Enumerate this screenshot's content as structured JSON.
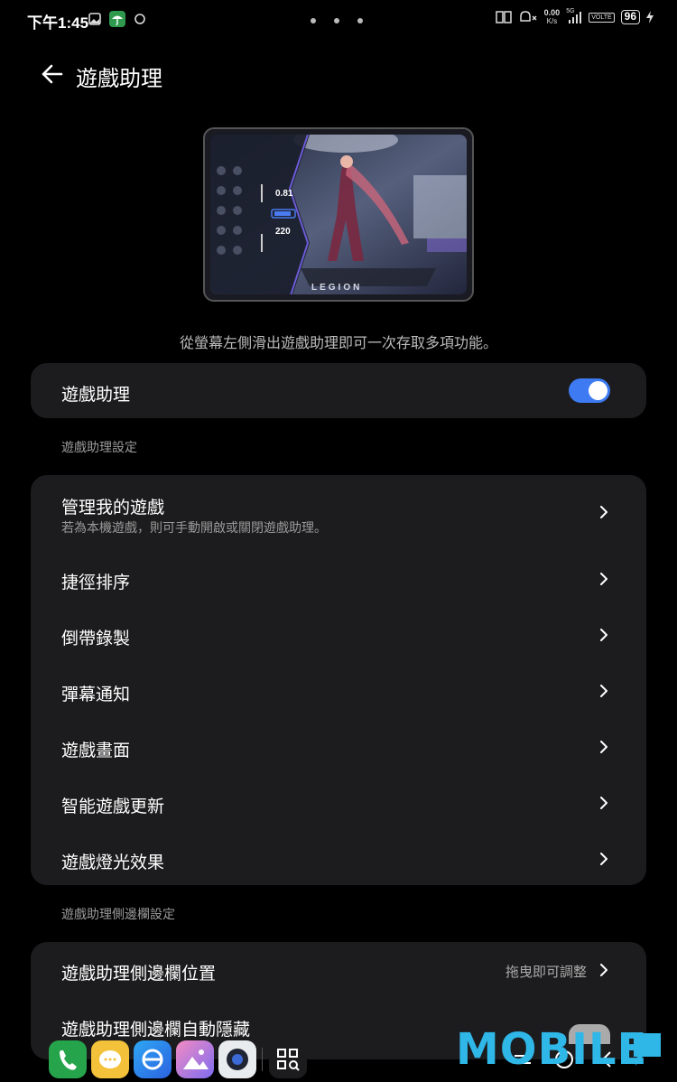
{
  "status_bar": {
    "time": "下午1:45",
    "net_speed_value": "0.00",
    "net_speed_unit": "K/s",
    "signal": "5G",
    "volte": "VOLTE",
    "battery": "96"
  },
  "header": {
    "title": "遊戲助理"
  },
  "preview": {
    "stat1": "0.81",
    "stat2": "220",
    "logo_text": "LEGION"
  },
  "caption": "從螢幕左側滑出遊戲助理即可一次存取多項功能。",
  "toggle_card": {
    "label": "遊戲助理",
    "enabled": true
  },
  "section1": {
    "heading": "遊戲助理設定",
    "items": [
      {
        "label": "管理我的遊戲",
        "sub": "若為本機遊戲，則可手動開啟或關閉遊戲助理。"
      },
      {
        "label": "捷徑排序"
      },
      {
        "label": "倒帶錄製"
      },
      {
        "label": "彈幕通知"
      },
      {
        "label": "遊戲畫面"
      },
      {
        "label": "智能遊戲更新"
      },
      {
        "label": "遊戲燈光效果"
      }
    ]
  },
  "section2": {
    "heading": "遊戲助理側邊欄設定",
    "items": [
      {
        "label": "遊戲助理側邊欄位置",
        "value": "拖曳即可調整"
      },
      {
        "label": "遊戲助理側邊欄自動隱藏"
      }
    ]
  },
  "watermark": "MOBILE",
  "colors": {
    "accent": "#3e7bf2",
    "card_bg": "#1c1c1e",
    "background": "#000000"
  }
}
